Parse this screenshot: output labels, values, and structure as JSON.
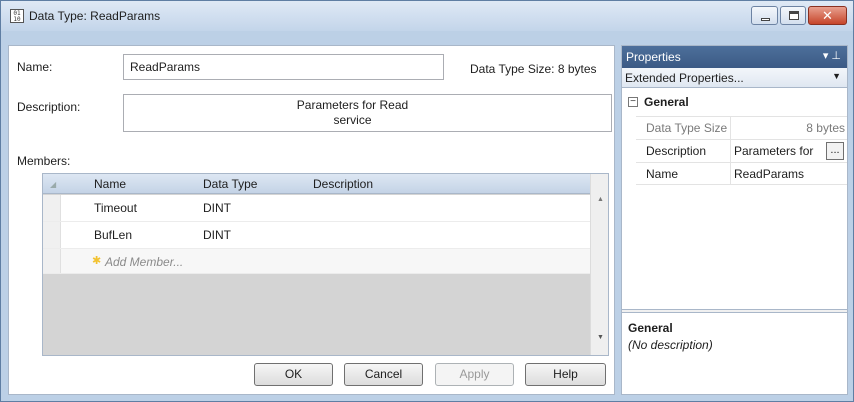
{
  "window": {
    "title": "Data Type: ReadParams",
    "icon_label": "01 10",
    "close_glyph": "✕"
  },
  "form": {
    "name_label": "Name:",
    "name_value": "ReadParams",
    "size_text": "Data Type Size: 8 bytes",
    "description_label": "Description:",
    "description_line1": "Parameters for Read",
    "description_line2": "service",
    "members_label": "Members:"
  },
  "members": {
    "columns": [
      "Name",
      "Data Type",
      "Description"
    ],
    "rows": [
      {
        "name": "Timeout",
        "data_type": "DINT",
        "description": ""
      },
      {
        "name": "BufLen",
        "data_type": "DINT",
        "description": ""
      }
    ],
    "add_placeholder": "Add Member..."
  },
  "buttons": {
    "ok": "OK",
    "cancel": "Cancel",
    "apply": "Apply",
    "help": "Help"
  },
  "properties": {
    "title": "Properties",
    "pin_icons": "▾ ⊥",
    "view_select": "Extended Properties...",
    "category": "General",
    "rows": [
      {
        "key": "Data Type Size",
        "value": "8 bytes"
      },
      {
        "key": "Description",
        "value": "Parameters for"
      },
      {
        "key": "Name",
        "value": "ReadParams"
      }
    ],
    "ellipsis": "...",
    "help_title": "General",
    "help_desc": "(No description)"
  }
}
